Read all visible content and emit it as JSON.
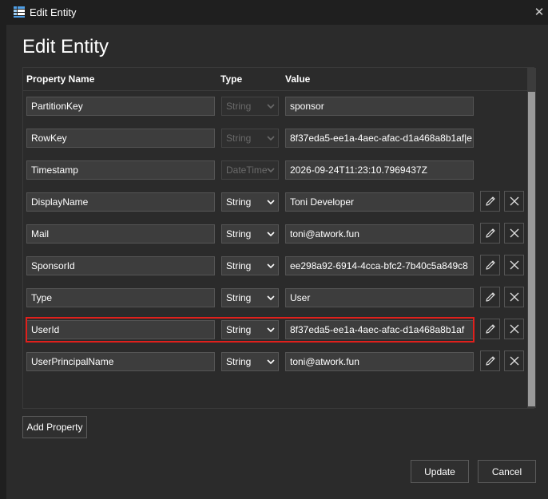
{
  "window": {
    "title": "Edit Entity",
    "close_glyph": "✕"
  },
  "dialog": {
    "title": "Edit Entity"
  },
  "grid": {
    "headers": {
      "name": "Property Name",
      "type": "Type",
      "value": "Value"
    },
    "rows": [
      {
        "name": "PartitionKey",
        "type": "String",
        "value": "sponsor",
        "editable": false
      },
      {
        "name": "RowKey",
        "type": "String",
        "value": "8f37eda5-ee1a-4aec-afac-d1a468a8b1af|e",
        "editable": false
      },
      {
        "name": "Timestamp",
        "type": "DateTime",
        "value": "2026-09-24T11:23:10.7969437Z",
        "editable": false
      },
      {
        "name": "DisplayName",
        "type": "String",
        "value": "Toni Developer",
        "editable": true
      },
      {
        "name": "Mail",
        "type": "String",
        "value": "toni@atwork.fun",
        "editable": true
      },
      {
        "name": "SponsorId",
        "type": "String",
        "value": "ee298a92-6914-4cca-bfc2-7b40c5a849c8",
        "editable": true
      },
      {
        "name": "Type",
        "type": "String",
        "value": "User",
        "editable": true
      },
      {
        "name": "UserId",
        "type": "String",
        "value": "8f37eda5-ee1a-4aec-afac-d1a468a8b1af",
        "editable": true,
        "highlighted": true
      },
      {
        "name": "UserPrincipalName",
        "type": "String",
        "value": "toni@atwork.fun",
        "editable": true
      }
    ]
  },
  "buttons": {
    "add_property": "Add Property",
    "update": "Update",
    "cancel": "Cancel"
  },
  "icons": {
    "app": "table-icon",
    "edit": "pencil-icon",
    "delete": "close-icon",
    "dropdown": "chevron-down-icon"
  },
  "colors": {
    "background": "#1f1f1f",
    "panel": "#2b2b2b",
    "field": "#3d3d3d",
    "highlight": "#e0201c"
  }
}
